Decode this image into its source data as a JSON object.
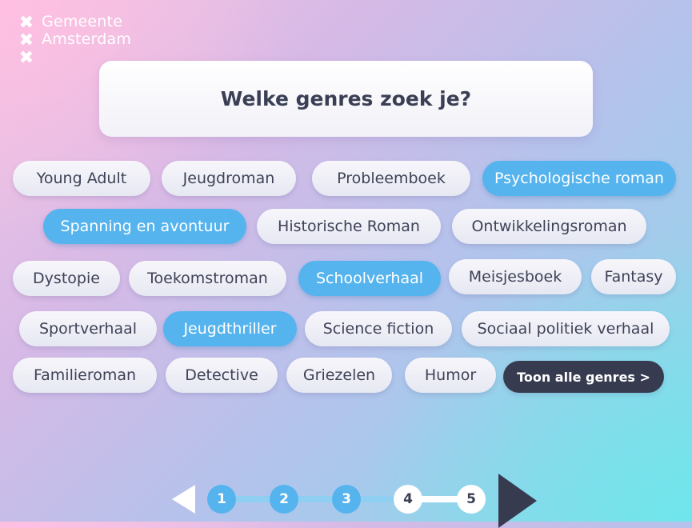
{
  "logo": {
    "line1": "Gemeente",
    "line2": "Amsterdam",
    "cross": "✖"
  },
  "question": "Welke genres zoek je?",
  "genres": [
    {
      "label": "Young Adult",
      "selected": false
    },
    {
      "label": "Jeugdroman",
      "selected": false
    },
    {
      "label": "Probleemboek",
      "selected": false
    },
    {
      "label": "Psychologische roman",
      "selected": true
    },
    {
      "label": "Spanning en avontuur",
      "selected": true
    },
    {
      "label": "Historische Roman",
      "selected": false
    },
    {
      "label": "Ontwikkelingsroman",
      "selected": false
    },
    {
      "label": "Dystopie",
      "selected": false
    },
    {
      "label": "Toekomstroman",
      "selected": false
    },
    {
      "label": "Schoolverhaal",
      "selected": true
    },
    {
      "label": "Meisjesboek",
      "selected": false
    },
    {
      "label": "Fantasy",
      "selected": false
    },
    {
      "label": "Sportverhaal",
      "selected": false
    },
    {
      "label": "Jeugdthriller",
      "selected": true
    },
    {
      "label": "Science fiction",
      "selected": false
    },
    {
      "label": "Sociaal politiek verhaal",
      "selected": false
    },
    {
      "label": "Familieroman",
      "selected": false
    },
    {
      "label": "Detective",
      "selected": false
    },
    {
      "label": "Griezelen",
      "selected": false
    },
    {
      "label": "Humor",
      "selected": false
    }
  ],
  "show_all_label": "Toon alle genres >",
  "pagination": {
    "steps": [
      "1",
      "2",
      "3",
      "4",
      "5"
    ],
    "current_step": 4,
    "completed_steps": 3
  },
  "colors": {
    "selected": "#55b3ee",
    "dark": "#373b50"
  }
}
